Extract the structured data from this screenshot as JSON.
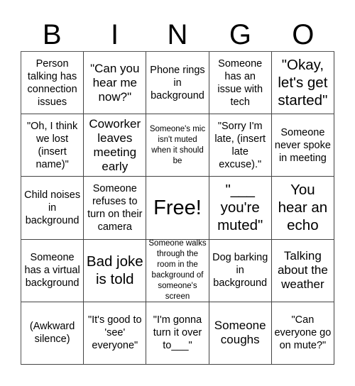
{
  "header": {
    "letters": [
      "B",
      "I",
      "N",
      "G",
      "O"
    ]
  },
  "board": {
    "rows": [
      [
        {
          "text": "Person talking has connection issues",
          "size": "m"
        },
        {
          "text": "\"Can you hear me now?\"",
          "size": "l"
        },
        {
          "text": "Phone rings in background",
          "size": "m"
        },
        {
          "text": "Someone has an issue with tech",
          "size": "m"
        },
        {
          "text": "\"Okay, let's get started\"",
          "size": "xl"
        }
      ],
      [
        {
          "text": "\"Oh, I think we lost (insert name)\"",
          "size": "m"
        },
        {
          "text": "Coworker leaves meeting early",
          "size": "l"
        },
        {
          "text": "Someone's mic isn't muted when it should be",
          "size": "s"
        },
        {
          "text": "\"Sorry I'm late, (insert late excuse).\"",
          "size": "m"
        },
        {
          "text": "Someone never spoke in meeting",
          "size": "m"
        }
      ],
      [
        {
          "text": "Child noises in background",
          "size": "m"
        },
        {
          "text": "Someone refuses to turn on their camera",
          "size": "m"
        },
        {
          "text": "Free!",
          "size": "xxl"
        },
        {
          "text": "\"___ you're muted\"",
          "size": "xl"
        },
        {
          "text": "You hear an echo",
          "size": "xl"
        }
      ],
      [
        {
          "text": "Someone has a virtual background",
          "size": "m"
        },
        {
          "text": "Bad joke is told",
          "size": "xl"
        },
        {
          "text": "Someone walks through the room in the background of someone's screen",
          "size": "s"
        },
        {
          "text": "Dog barking in background",
          "size": "m"
        },
        {
          "text": "Talking about the weather",
          "size": "l"
        }
      ],
      [
        {
          "text": "(Awkward silence)",
          "size": "m"
        },
        {
          "text": "\"It's good to 'see' everyone\"",
          "size": "m"
        },
        {
          "text": "\"I'm gonna turn it over to___\"",
          "size": "m"
        },
        {
          "text": "Someone coughs",
          "size": "l"
        },
        {
          "text": "\"Can everyone go on mute?\"",
          "size": "m"
        }
      ]
    ]
  }
}
